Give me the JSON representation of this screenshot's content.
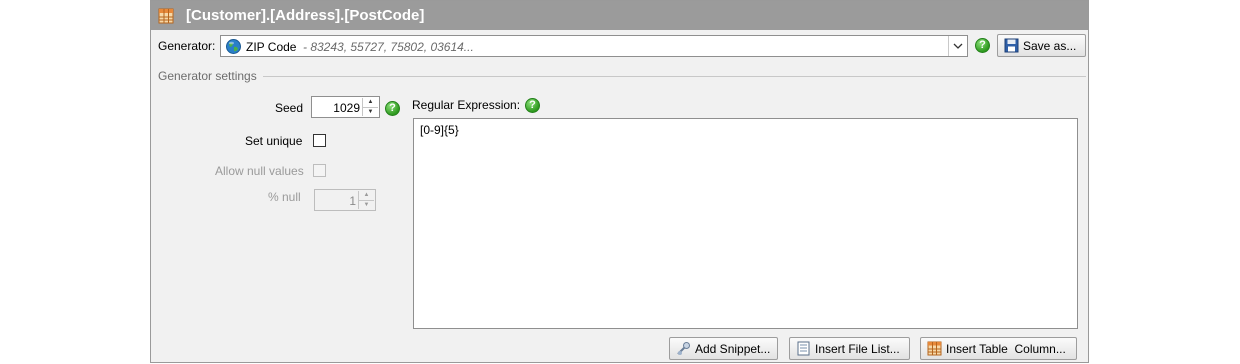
{
  "title": "[Customer].[Address].[PostCode]",
  "generator": {
    "label": "Generator:",
    "selected_name": "ZIP Code",
    "sample_values": "- 83243, 55727, 75802, 03614...",
    "save_label": "Save as..."
  },
  "settings": {
    "section_label": "Generator settings",
    "seed_label": "Seed",
    "seed_value": "1029",
    "set_unique_label": "Set unique",
    "set_unique_checked": false,
    "allow_null_label": "Allow null values",
    "allow_null_checked": false,
    "pct_null_label": "% null",
    "pct_null_value": "1"
  },
  "regex": {
    "label": "Regular Expression:",
    "value": "[0-9]{5}"
  },
  "buttons": {
    "add_snippet": "Add Snippet...",
    "insert_file_list": "Insert File List...",
    "insert_table_column": "Insert Table  Column..."
  },
  "icons": {
    "title": "table-grid-icon",
    "generator": "globe-icon",
    "help": "help-icon",
    "save": "floppy-disk-icon",
    "snippet": "snippet-icon",
    "file_list": "file-list-icon",
    "table_column": "table-column-icon"
  },
  "colors": {
    "titlebar": "#9b9b9b",
    "panel": "#f1f1f1",
    "help_green": "#2f9a1f"
  }
}
